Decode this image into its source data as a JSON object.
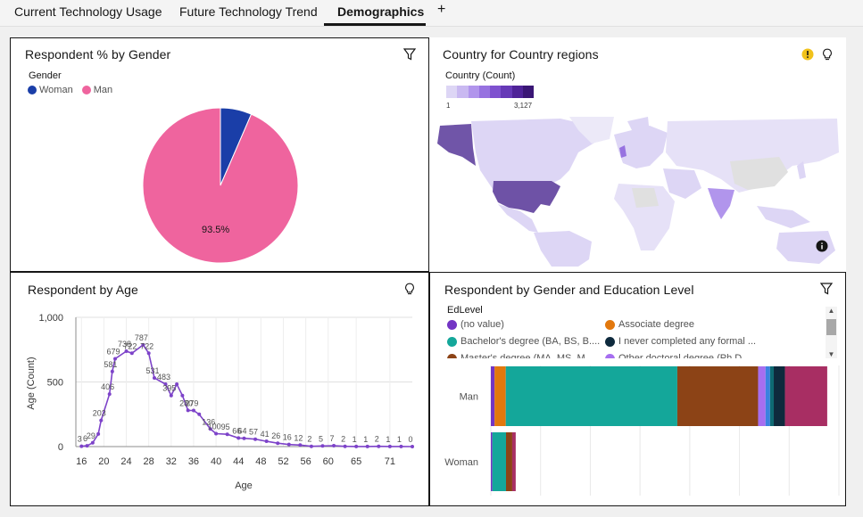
{
  "tabs": [
    {
      "label": "Current Technology Usage",
      "active": false
    },
    {
      "label": "Future Technology Trend",
      "active": false
    },
    {
      "label": "Demographics",
      "active": true
    }
  ],
  "add_tab_label": "+",
  "gender_panel": {
    "title": "Respondent % by Gender",
    "legend_title": "Gender",
    "legend": [
      {
        "label": "Woman",
        "color": "#1a3ea8"
      },
      {
        "label": "Man",
        "color": "#ef649e"
      }
    ],
    "slice_label": "93.5%"
  },
  "map_panel": {
    "title": "Country for Country regions",
    "scale_title": "Country (Count)",
    "scale_min": "1",
    "scale_max": "3,127",
    "scale_colors": [
      "#ddd6f5",
      "#c9b9f1",
      "#b195ec",
      "#9772e0",
      "#7e51cf",
      "#6639b7",
      "#4f2398",
      "#3a1675"
    ]
  },
  "age_panel": {
    "title": "Respondent by Age",
    "y_label": "Age (Count)",
    "x_label": "Age"
  },
  "edu_panel": {
    "title": "Respondent by Gender and Education Level",
    "legend_title": "EdLevel",
    "legend": [
      {
        "label": "(no value)",
        "color": "#7335c4"
      },
      {
        "label": "Associate degree",
        "color": "#e2780d"
      },
      {
        "label": "Bachelor's degree (BA, BS, B....",
        "color": "#14a79a"
      },
      {
        "label": "I never completed any formal ...",
        "color": "#0e2a3d"
      },
      {
        "label": "Master's degree (MA, MS, M...",
        "color": "#8c4316"
      },
      {
        "label": "Other doctoral degree (Ph.D....",
        "color": "#a66ef0"
      }
    ],
    "row_labels": [
      "Man",
      "Woman"
    ]
  },
  "chart_data": [
    {
      "type": "pie",
      "title": "Respondent % by Gender",
      "categories": [
        "Woman",
        "Man"
      ],
      "values": [
        6.5,
        93.5
      ]
    },
    {
      "type": "line",
      "title": "Respondent by Age",
      "xlabel": "Age",
      "ylabel": "Age (Count)",
      "ylim": [
        0,
        1000
      ],
      "yticks": [
        "0",
        "500",
        "1,000"
      ],
      "xticks": [
        "16",
        "20",
        "24",
        "28",
        "32",
        "36",
        "40",
        "44",
        "48",
        "52",
        "56",
        "60",
        "65",
        "71"
      ],
      "points": [
        {
          "x": 16,
          "y": 3,
          "label": "3"
        },
        {
          "x": 17,
          "y": 6,
          "label": "6"
        },
        {
          "x": 18,
          "y": 29,
          "label": "29"
        },
        {
          "x": 19,
          "y": 97,
          "label": ""
        },
        {
          "x": 19.5,
          "y": 203,
          "label": "203"
        },
        {
          "x": 21,
          "y": 406,
          "label": "406"
        },
        {
          "x": 21.5,
          "y": 581,
          "label": "581"
        },
        {
          "x": 22,
          "y": 679,
          "label": "679"
        },
        {
          "x": 24,
          "y": 738,
          "label": "738"
        },
        {
          "x": 25,
          "y": 722,
          "label": "722"
        },
        {
          "x": 27,
          "y": 787,
          "label": "787"
        },
        {
          "x": 28,
          "y": 722,
          "label": "722"
        },
        {
          "x": 29,
          "y": 531,
          "label": "531"
        },
        {
          "x": 31,
          "y": 483,
          "label": "483"
        },
        {
          "x": 32,
          "y": 395,
          "label": "395"
        },
        {
          "x": 33,
          "y": 483,
          "label": ""
        },
        {
          "x": 34,
          "y": 395,
          "label": ""
        },
        {
          "x": 35,
          "y": 280,
          "label": "280"
        },
        {
          "x": 36,
          "y": 279,
          "label": "279"
        },
        {
          "x": 37,
          "y": 250,
          "label": ""
        },
        {
          "x": 39,
          "y": 136,
          "label": "136"
        },
        {
          "x": 40,
          "y": 100,
          "label": "100"
        },
        {
          "x": 42,
          "y": 95,
          "label": "95"
        },
        {
          "x": 44,
          "y": 66,
          "label": "66"
        },
        {
          "x": 45,
          "y": 64,
          "label": "64"
        },
        {
          "x": 47,
          "y": 57,
          "label": "57"
        },
        {
          "x": 49,
          "y": 41,
          "label": "41"
        },
        {
          "x": 51,
          "y": 26,
          "label": "26"
        },
        {
          "x": 53,
          "y": 16,
          "label": "16"
        },
        {
          "x": 55,
          "y": 12,
          "label": "12"
        },
        {
          "x": 57,
          "y": 2,
          "label": "2"
        },
        {
          "x": 59,
          "y": 5,
          "label": "5"
        },
        {
          "x": 61,
          "y": 7,
          "label": "7"
        },
        {
          "x": 63,
          "y": 2,
          "label": "2"
        },
        {
          "x": 65,
          "y": 1,
          "label": "1"
        },
        {
          "x": 67,
          "y": 1,
          "label": "1"
        },
        {
          "x": 69,
          "y": 2,
          "label": "2"
        },
        {
          "x": 71,
          "y": 1,
          "label": "1"
        },
        {
          "x": 73,
          "y": 1,
          "label": "1"
        },
        {
          "x": 75,
          "y": 0,
          "label": "0"
        }
      ]
    },
    {
      "type": "bar",
      "title": "Respondent by Gender and Education Level",
      "orientation": "horizontal-stacked",
      "categories": [
        "Man",
        "Woman"
      ],
      "series": [
        {
          "name": "(no value)",
          "color": "#7335c4",
          "values": [
            15,
            6
          ]
        },
        {
          "name": "Associate degree",
          "color": "#e2780d",
          "values": [
            45,
            0
          ]
        },
        {
          "name": "Bachelor's degree (BA, BS, B....",
          "color": "#14a79a",
          "values": [
            690,
            55
          ]
        },
        {
          "name": "Master's degree (MA, MS, M...",
          "color": "#8c4316",
          "values": [
            325,
            25
          ]
        },
        {
          "name": "Other doctoral degree (Ph.D....",
          "color": "#a66ef0",
          "values": [
            30,
            0
          ]
        },
        {
          "name": "",
          "color": "#3b82e0",
          "values": [
            18,
            0
          ]
        },
        {
          "name": "",
          "color": "#0e6a73",
          "values": [
            15,
            0
          ]
        },
        {
          "name": "I never completed any formal ...",
          "color": "#0e2a3d",
          "values": [
            45,
            0
          ]
        },
        {
          "name": "",
          "color": "#a82e63",
          "values": [
            170,
            14
          ]
        }
      ],
      "xlim": [
        0,
        1400
      ]
    }
  ]
}
